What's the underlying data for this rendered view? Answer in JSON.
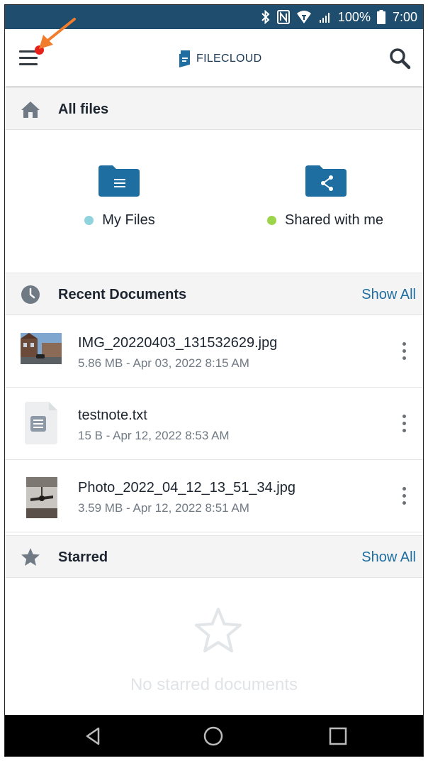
{
  "status_bar": {
    "battery_text": "100%",
    "time": "7:00",
    "icons": [
      "bluetooth-icon",
      "nfc-icon",
      "wifi-icon",
      "signal-icon",
      "battery-icon"
    ]
  },
  "app_bar": {
    "logo_text": "FILECLOUD",
    "menu_icon": "hamburger-menu-icon",
    "search_icon": "search-icon",
    "notification_dot_color": "#e8201a",
    "annotation_arrow_color": "#f07c2c"
  },
  "all_files": {
    "title": "All files",
    "icon": "home-icon",
    "shortcuts": [
      {
        "label": "My Files",
        "icon": "folder-document-icon",
        "dot_color": "#8fd3dd"
      },
      {
        "label": "Shared with me",
        "icon": "folder-share-icon",
        "dot_color": "#9cd54a"
      }
    ]
  },
  "recent": {
    "title": "Recent Documents",
    "icon": "clock-icon",
    "show_all": "Show All",
    "files": [
      {
        "name": "IMG_20220403_131532629.jpg",
        "meta": "5.86 MB - Apr 03, 2022 8:15 AM",
        "thumb": "street-photo-thumbnail"
      },
      {
        "name": "testnote.txt",
        "meta": "15 B - Apr 12, 2022 8:53 AM",
        "thumb": "text-file-icon"
      },
      {
        "name": "Photo_2022_04_12_13_51_34.jpg",
        "meta": "3.59 MB - Apr 12, 2022 8:51 AM",
        "thumb": "ceiling-fan-photo-thumbnail"
      }
    ]
  },
  "starred": {
    "title": "Starred",
    "icon": "star-icon",
    "show_all": "Show All",
    "empty_text": "No starred documents"
  },
  "nav_bar": {
    "icons": [
      "back-icon",
      "home-circle-icon",
      "recents-square-icon"
    ]
  },
  "colors": {
    "status_bar": "#1f4d6e",
    "brand_blue": "#1f6ea1",
    "folder_blue": "#1f6ea1"
  }
}
